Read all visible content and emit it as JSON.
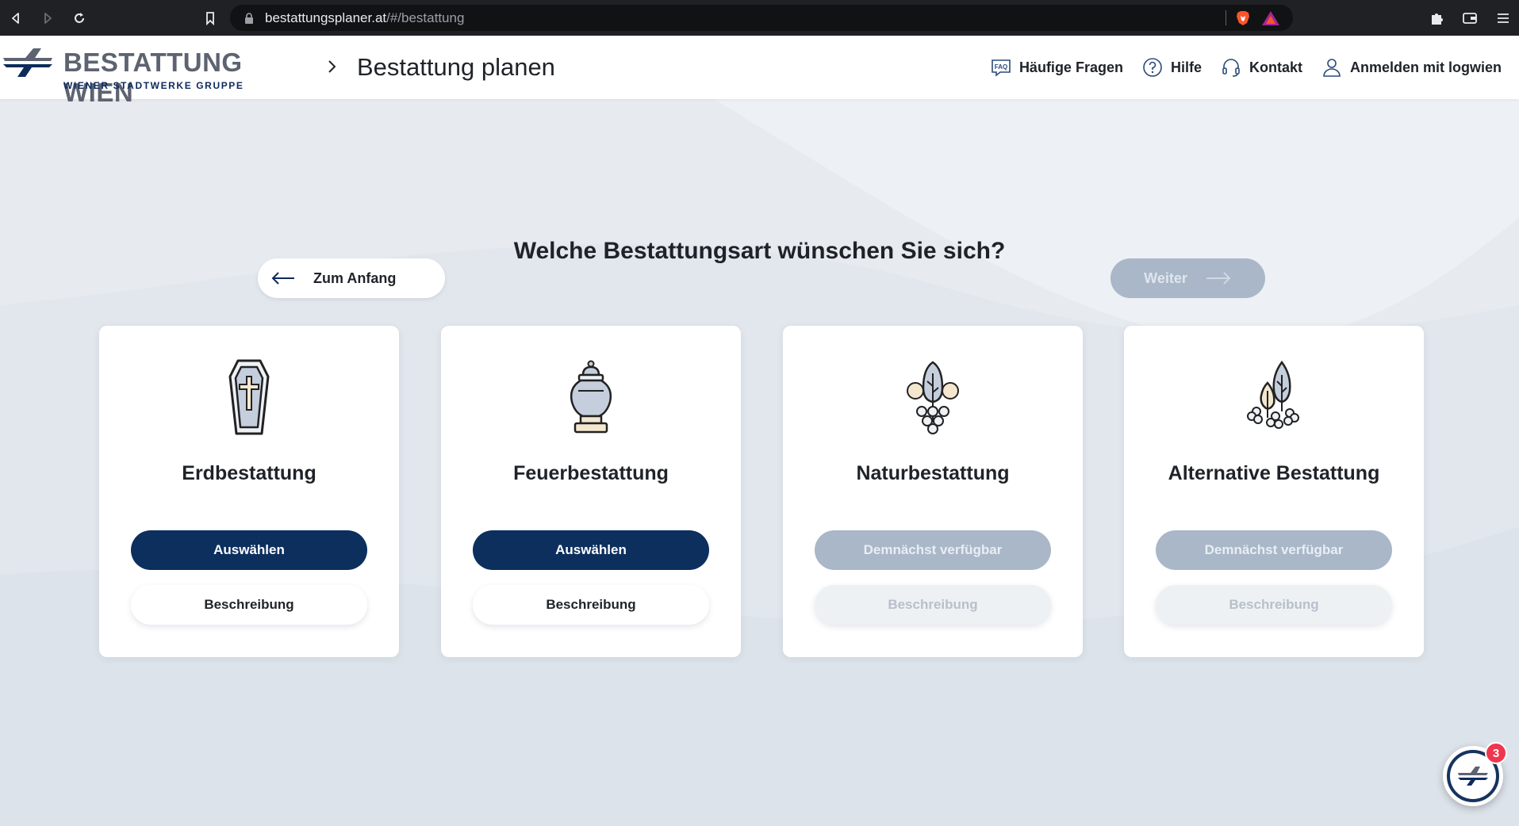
{
  "browser": {
    "url_host": "bestattungsplaner.at",
    "url_path": "/#/bestattung",
    "icons": [
      "back-icon",
      "forward-icon",
      "reload-icon",
      "bookmark-icon",
      "lock-icon",
      "brave-shield-icon",
      "brave-rewards-icon",
      "extensions-icon",
      "wallet-icon",
      "menu-icon"
    ]
  },
  "header": {
    "logo_name": "BESTATTUNG WIEN",
    "logo_sub": "WIENER STADTWERKE GRUPPE",
    "page_title": "Bestattung planen",
    "nav": [
      {
        "label": "Häufige Fragen",
        "icon": "faq-icon"
      },
      {
        "label": "Hilfe",
        "icon": "help-icon"
      },
      {
        "label": "Kontakt",
        "icon": "headset-icon"
      },
      {
        "label": "Anmelden mit logwien",
        "icon": "user-icon"
      }
    ]
  },
  "main": {
    "question": "Welche Bestattungsart wünschen Sie sich?",
    "back_label": "Zum Anfang",
    "next_label": "Weiter",
    "cards": [
      {
        "title": "Erdbestattung",
        "primary": "Auswählen",
        "secondary": "Beschreibung",
        "icon": "coffin-icon",
        "enabled": true
      },
      {
        "title": "Feuerbestattung",
        "primary": "Auswählen",
        "secondary": "Beschreibung",
        "icon": "urn-icon",
        "enabled": true
      },
      {
        "title": "Naturbestattung",
        "primary": "Demnächst verfügbar",
        "secondary": "Beschreibung",
        "icon": "tree-flowers-icon",
        "enabled": false
      },
      {
        "title": "Alternative Bestattung",
        "primary": "Demnächst verfügbar",
        "secondary": "Beschreibung",
        "icon": "leaves-flowers-icon",
        "enabled": false
      }
    ]
  },
  "chat": {
    "badge_count": "3",
    "icon": "chat-logo-icon"
  },
  "colors": {
    "brand_navy": "#0c2f5e",
    "disabled": "#a9b7c8",
    "background": "#e7ebf0",
    "badge": "#f0354e"
  }
}
